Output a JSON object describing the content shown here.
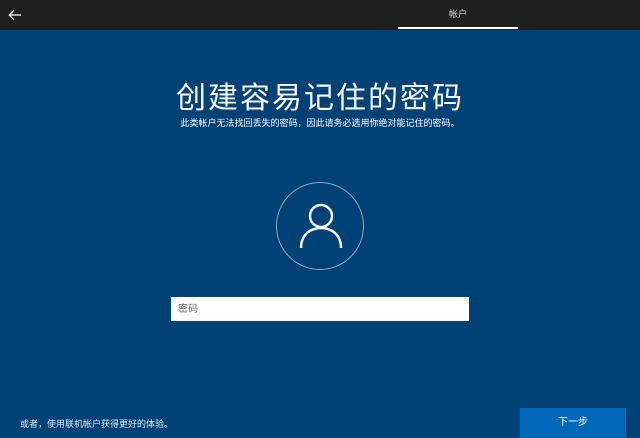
{
  "header": {
    "back_icon": "arrow-left-icon",
    "tab_label": "帐户"
  },
  "main": {
    "title": "创建容易记住的密码",
    "subtitle": "此类帐户无法找回丢失的密码，因此请务必选用你绝对能记住的密码。",
    "avatar_icon": "user-icon",
    "password_placeholder": "密码",
    "password_value": ""
  },
  "footer": {
    "alt_link": "或者，使用联机帐户获得更好的体验。",
    "next_label": "下一步"
  },
  "colors": {
    "background": "#004275",
    "topbar": "#1f1f1f",
    "button": "#0067b8"
  }
}
